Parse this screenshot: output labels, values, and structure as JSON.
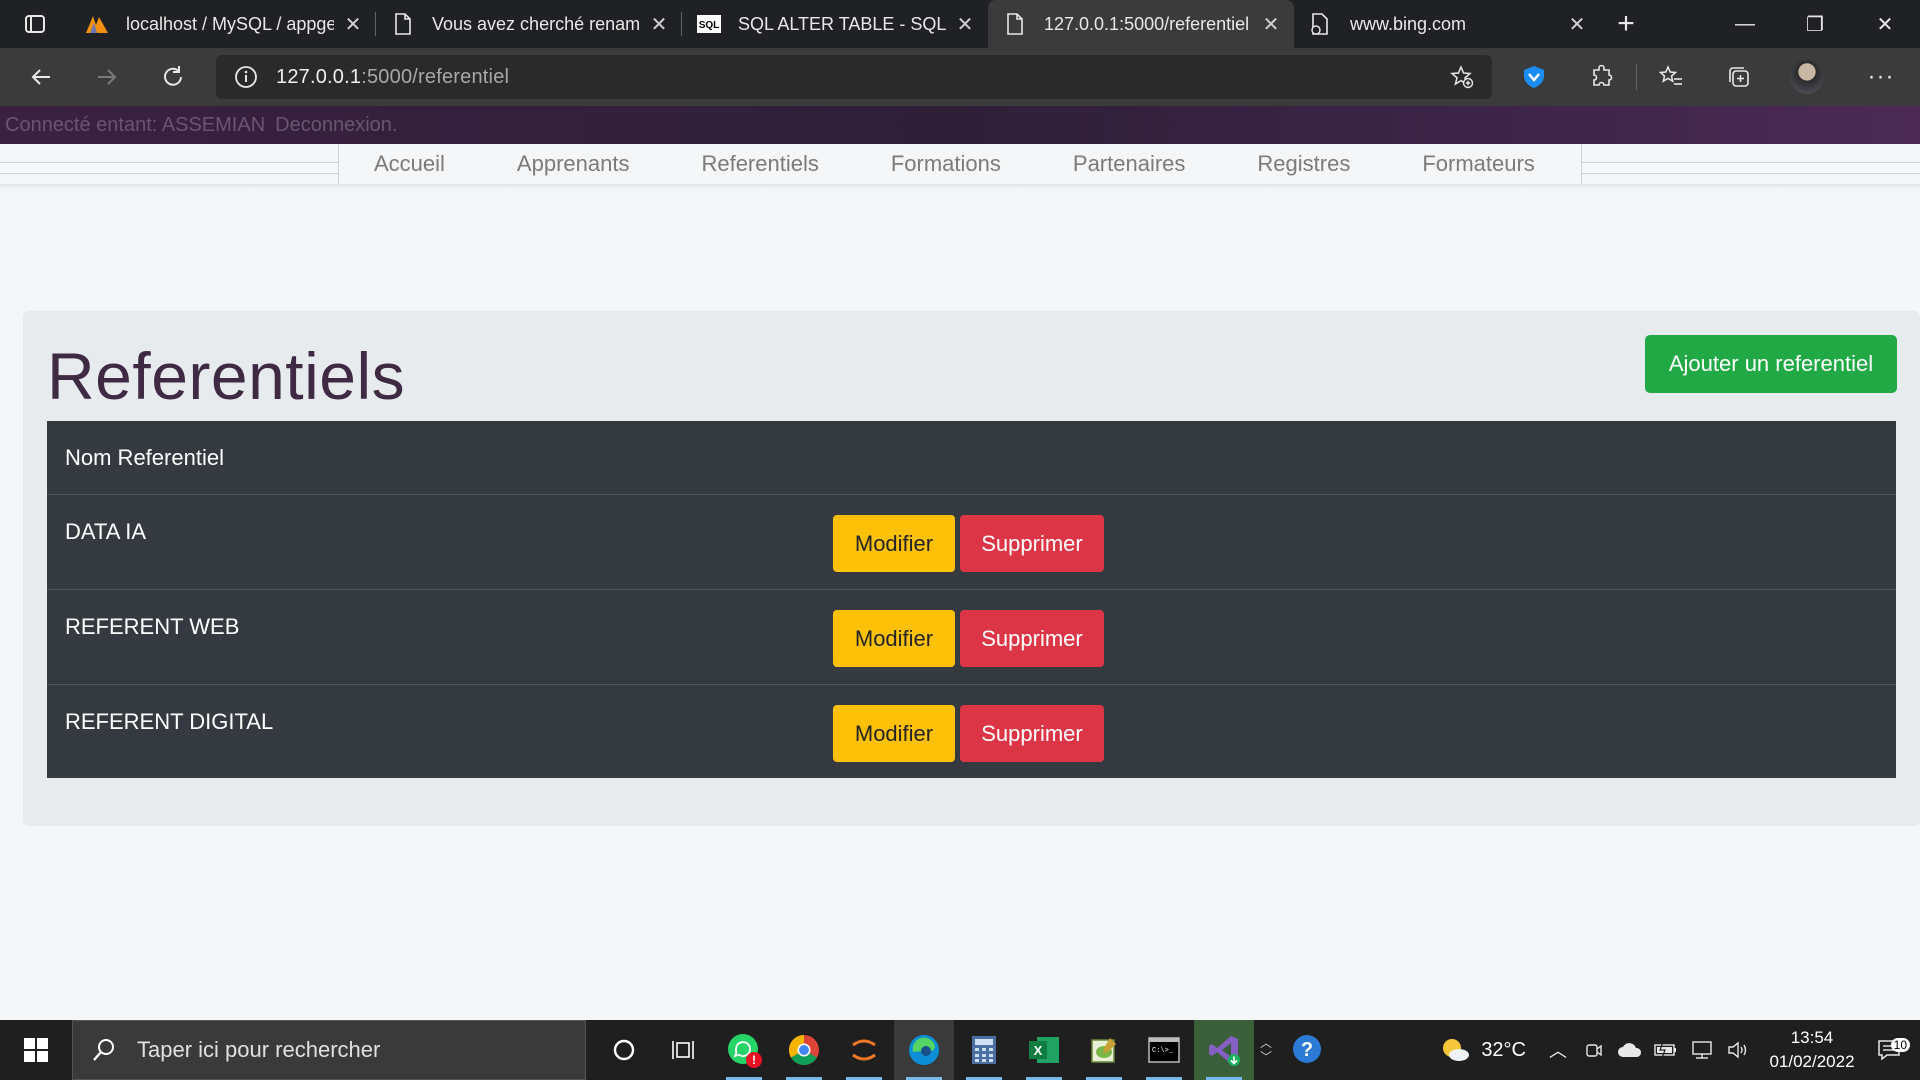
{
  "browser": {
    "tabs": [
      {
        "title": "localhost / MySQL / appge",
        "favicon": "phpmyadmin-icon",
        "active": false
      },
      {
        "title": "Vous avez cherché renam",
        "favicon": "document-icon",
        "active": false
      },
      {
        "title": "SQL ALTER TABLE - SQL",
        "favicon": "sql-icon",
        "active": false
      },
      {
        "title": "127.0.0.1:5000/referentiel",
        "favicon": "document-icon",
        "active": true
      },
      {
        "title": "www.bing.com",
        "favicon": "document-icon",
        "active": false
      }
    ],
    "url_host": "127.0.0.1",
    "url_path": ":5000/referentiel"
  },
  "header": {
    "connected_label": "Connecté entant: ASSEMIAN",
    "logout_label": "Deconnexion."
  },
  "nav": {
    "items": [
      "Accueil",
      "Apprenants",
      "Referentiels",
      "Formations",
      "Partenaires",
      "Registres",
      "Formateurs"
    ]
  },
  "main": {
    "title": "Referentiels",
    "add_button": "Ajouter un referentiel",
    "table": {
      "header": "Nom Referentiel",
      "rows": [
        {
          "name": "DATA IA",
          "edit": "Modifier",
          "delete": "Supprimer"
        },
        {
          "name": "REFERENT WEB",
          "edit": "Modifier",
          "delete": "Supprimer"
        },
        {
          "name": "REFERENT DIGITAL",
          "edit": "Modifier",
          "delete": "Supprimer"
        }
      ]
    }
  },
  "taskbar": {
    "search_placeholder": "Taper ici pour rechercher",
    "weather": "32°C",
    "time": "13:54",
    "date": "01/02/2022",
    "notifications": "10"
  },
  "colors": {
    "success": "#20a945",
    "warning": "#ffc107",
    "danger": "#dc3545",
    "table_dark": "#343a40",
    "title": "#3f2a44"
  }
}
